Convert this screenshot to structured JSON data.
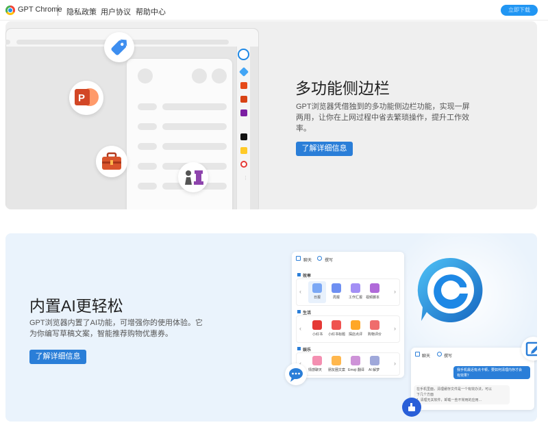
{
  "header": {
    "brand": "GPT Chrome",
    "nav": [
      "隐私政策",
      "用户协议",
      "帮助中心"
    ],
    "action_button": "立即下载"
  },
  "feature1": {
    "title": "多功能侧边栏",
    "desc_lines": [
      "GPT浏览器凭借独到的多功能侧边栏功能，实现一屏",
      "两用，让你在上网过程中省去繁琐操作，提升工作效",
      "率。"
    ],
    "button": "了解详细信息"
  },
  "feature2": {
    "title": "内置AI更轻松",
    "desc_lines": [
      "GPT浏览器内置了AI功能，可增强你的使用体验。它",
      "为你编写草稿文案，智能推荐购物优惠券。"
    ],
    "button": "了解详细信息",
    "card": {
      "tabs": [
        "聊天",
        "撰写"
      ],
      "groups": [
        {
          "name": "效率",
          "items": [
            "日报",
            "周报",
            "工作汇报",
            "视频脚本"
          ]
        },
        {
          "name": "生活",
          "items": [
            "小红书",
            "小红书标题",
            "探店点评",
            "购物评价"
          ]
        },
        {
          "name": "娱乐",
          "items": [
            "情感聊天",
            "朋友圈文案",
            "Emoji 翻译",
            "AI 解梦"
          ]
        }
      ]
    },
    "chat": {
      "tabs": [
        "聊天",
        "撰写"
      ],
      "user_msg": [
        "我手机最近有点卡顿，要如何清理内存才会",
        "有效果？"
      ],
      "reply": [
        "在手机里面，清理缓存文件是一个有效办法，可以",
        "下几个方面",
        "1. 清理无关软件，卸载一些不常用的应用…"
      ]
    }
  }
}
